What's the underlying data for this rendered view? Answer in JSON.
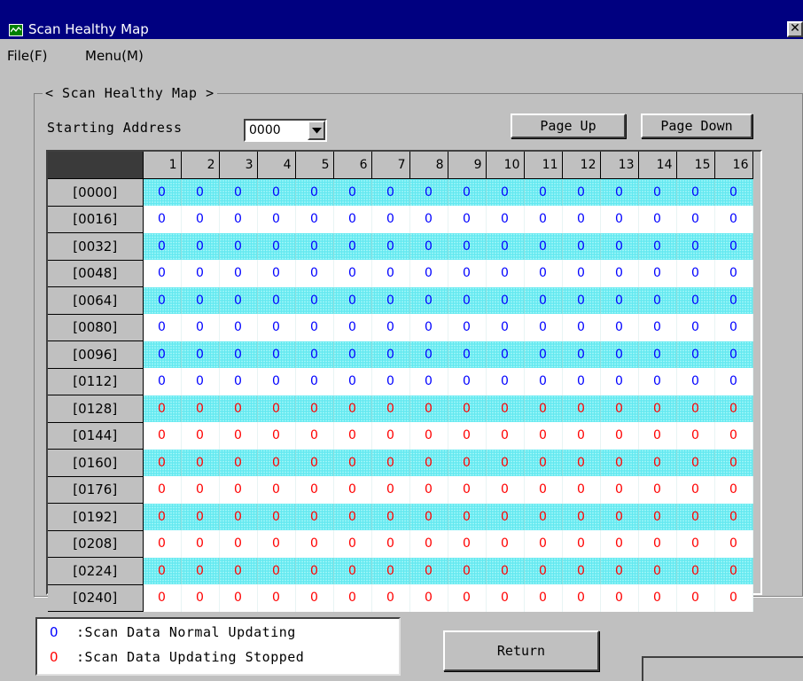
{
  "window": {
    "title": "Scan Healthy Map",
    "close_glyph": "✕"
  },
  "menu": {
    "file": "File(F)",
    "menu": "Menu(M)"
  },
  "group": {
    "legend": "< Scan Healthy Map >"
  },
  "controls": {
    "starting_address_label": "Starting Address",
    "starting_address_value": "0000",
    "page_up": "Page Up",
    "page_down": "Page Down"
  },
  "table": {
    "columns": [
      "1",
      "2",
      "3",
      "4",
      "5",
      "6",
      "7",
      "8",
      "9",
      "10",
      "11",
      "12",
      "13",
      "14",
      "15",
      "16"
    ],
    "rows": [
      {
        "label": "[0000]",
        "status": "normal",
        "values": [
          "0",
          "0",
          "0",
          "0",
          "0",
          "0",
          "0",
          "0",
          "0",
          "0",
          "0",
          "0",
          "0",
          "0",
          "0",
          "0"
        ]
      },
      {
        "label": "[0016]",
        "status": "normal",
        "values": [
          "0",
          "0",
          "0",
          "0",
          "0",
          "0",
          "0",
          "0",
          "0",
          "0",
          "0",
          "0",
          "0",
          "0",
          "0",
          "0"
        ]
      },
      {
        "label": "[0032]",
        "status": "normal",
        "values": [
          "0",
          "0",
          "0",
          "0",
          "0",
          "0",
          "0",
          "0",
          "0",
          "0",
          "0",
          "0",
          "0",
          "0",
          "0",
          "0"
        ]
      },
      {
        "label": "[0048]",
        "status": "normal",
        "values": [
          "0",
          "0",
          "0",
          "0",
          "0",
          "0",
          "0",
          "0",
          "0",
          "0",
          "0",
          "0",
          "0",
          "0",
          "0",
          "0"
        ]
      },
      {
        "label": "[0064]",
        "status": "normal",
        "values": [
          "0",
          "0",
          "0",
          "0",
          "0",
          "0",
          "0",
          "0",
          "0",
          "0",
          "0",
          "0",
          "0",
          "0",
          "0",
          "0"
        ]
      },
      {
        "label": "[0080]",
        "status": "normal",
        "values": [
          "0",
          "0",
          "0",
          "0",
          "0",
          "0",
          "0",
          "0",
          "0",
          "0",
          "0",
          "0",
          "0",
          "0",
          "0",
          "0"
        ]
      },
      {
        "label": "[0096]",
        "status": "normal",
        "values": [
          "0",
          "0",
          "0",
          "0",
          "0",
          "0",
          "0",
          "0",
          "0",
          "0",
          "0",
          "0",
          "0",
          "0",
          "0",
          "0"
        ]
      },
      {
        "label": "[0112]",
        "status": "normal",
        "values": [
          "0",
          "0",
          "0",
          "0",
          "0",
          "0",
          "0",
          "0",
          "0",
          "0",
          "0",
          "0",
          "0",
          "0",
          "0",
          "0"
        ]
      },
      {
        "label": "[0128]",
        "status": "stopped",
        "values": [
          "0",
          "0",
          "0",
          "0",
          "0",
          "0",
          "0",
          "0",
          "0",
          "0",
          "0",
          "0",
          "0",
          "0",
          "0",
          "0"
        ]
      },
      {
        "label": "[0144]",
        "status": "stopped",
        "values": [
          "0",
          "0",
          "0",
          "0",
          "0",
          "0",
          "0",
          "0",
          "0",
          "0",
          "0",
          "0",
          "0",
          "0",
          "0",
          "0"
        ]
      },
      {
        "label": "[0160]",
        "status": "stopped",
        "values": [
          "0",
          "0",
          "0",
          "0",
          "0",
          "0",
          "0",
          "0",
          "0",
          "0",
          "0",
          "0",
          "0",
          "0",
          "0",
          "0"
        ]
      },
      {
        "label": "[0176]",
        "status": "stopped",
        "values": [
          "0",
          "0",
          "0",
          "0",
          "0",
          "0",
          "0",
          "0",
          "0",
          "0",
          "0",
          "0",
          "0",
          "0",
          "0",
          "0"
        ]
      },
      {
        "label": "[0192]",
        "status": "stopped",
        "values": [
          "0",
          "0",
          "0",
          "0",
          "0",
          "0",
          "0",
          "0",
          "0",
          "0",
          "0",
          "0",
          "0",
          "0",
          "0",
          "0"
        ]
      },
      {
        "label": "[0208]",
        "status": "stopped",
        "values": [
          "0",
          "0",
          "0",
          "0",
          "0",
          "0",
          "0",
          "0",
          "0",
          "0",
          "0",
          "0",
          "0",
          "0",
          "0",
          "0"
        ]
      },
      {
        "label": "[0224]",
        "status": "stopped",
        "values": [
          "0",
          "0",
          "0",
          "0",
          "0",
          "0",
          "0",
          "0",
          "0",
          "0",
          "0",
          "0",
          "0",
          "0",
          "0",
          "0"
        ]
      },
      {
        "label": "[0240]",
        "status": "stopped",
        "values": [
          "0",
          "0",
          "0",
          "0",
          "0",
          "0",
          "0",
          "0",
          "0",
          "0",
          "0",
          "0",
          "0",
          "0",
          "0",
          "0"
        ]
      }
    ]
  },
  "legend": {
    "normal_symbol": "0",
    "normal_text": ":Scan Data Normal Updating",
    "stopped_symbol": "0",
    "stopped_text": ":Scan Data Updating Stopped"
  },
  "buttons": {
    "return": "Return"
  },
  "colors": {
    "normal": "#0000ff",
    "stopped": "#ff0000",
    "titlebar": "#000080",
    "row_highlight": "#63e8f0"
  }
}
